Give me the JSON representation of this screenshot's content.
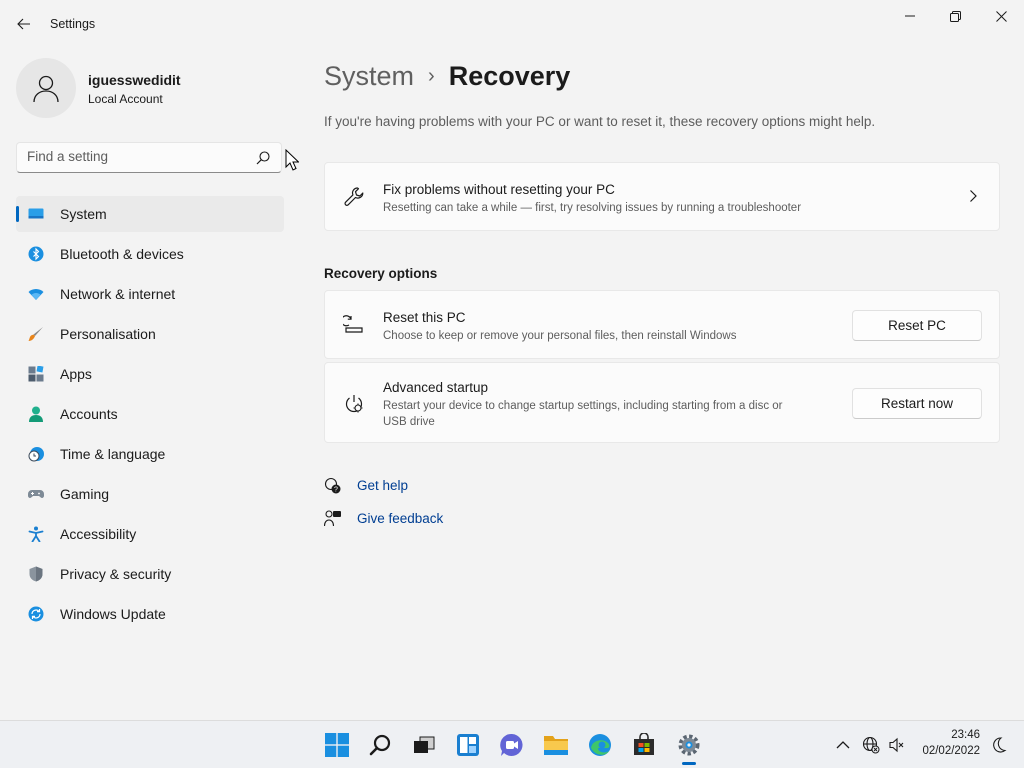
{
  "window": {
    "app_title": "Settings",
    "controls": [
      "minimize-icon",
      "restore-icon",
      "close-icon"
    ]
  },
  "profile": {
    "name": "iguesswedidit",
    "account_type": "Local Account"
  },
  "search": {
    "placeholder": "Find a setting",
    "value": ""
  },
  "sidebar": {
    "items": [
      {
        "label": "System",
        "icon": "system-icon",
        "active": true
      },
      {
        "label": "Bluetooth & devices",
        "icon": "bluetooth-icon"
      },
      {
        "label": "Network & internet",
        "icon": "wifi-icon"
      },
      {
        "label": "Personalisation",
        "icon": "brush-icon"
      },
      {
        "label": "Apps",
        "icon": "apps-icon"
      },
      {
        "label": "Accounts",
        "icon": "person-icon"
      },
      {
        "label": "Time & language",
        "icon": "clock-globe-icon"
      },
      {
        "label": "Gaming",
        "icon": "gamepad-icon"
      },
      {
        "label": "Accessibility",
        "icon": "accessibility-icon"
      },
      {
        "label": "Privacy & security",
        "icon": "shield-icon"
      },
      {
        "label": "Windows Update",
        "icon": "update-icon"
      }
    ]
  },
  "breadcrumb": {
    "parent": "System",
    "separator": "›",
    "current": "Recovery"
  },
  "subtitle": "If you're having problems with your PC or want to reset it, these recovery options might help.",
  "fix_card": {
    "title": "Fix problems without resetting your PC",
    "description": "Resetting can take a while — first, try resolving issues by running a troubleshooter",
    "icon": "wrench-icon"
  },
  "recovery_options": {
    "heading": "Recovery options",
    "items": [
      {
        "title": "Reset this PC",
        "description": "Choose to keep or remove your personal files, then reinstall Windows",
        "button": "Reset PC",
        "icon": "reset-pc-icon"
      },
      {
        "title": "Advanced startup",
        "description_line1": "Restart your device to change startup settings, including starting from a disc or",
        "description_line2": "USB drive",
        "button": "Restart now",
        "icon": "advanced-startup-icon"
      }
    ]
  },
  "links": {
    "get_help": "Get help",
    "give_feedback": "Give feedback"
  },
  "taskbar": {
    "apps": [
      "start-icon",
      "search-icon",
      "task-view-icon",
      "widgets-icon",
      "chat-icon",
      "file-explorer-icon",
      "edge-icon",
      "store-icon",
      "settings-icon"
    ],
    "active_app": "settings-icon",
    "tray": [
      "chevron-up-icon",
      "network-icon",
      "volume-muted-icon"
    ],
    "time": "23:46",
    "date": "02/02/2022",
    "notification_icon": "moon-icon"
  },
  "colors": {
    "accent": "#0067c0",
    "link": "#003e92",
    "background": "#f3f3f3",
    "card": "#fbfbfb"
  }
}
